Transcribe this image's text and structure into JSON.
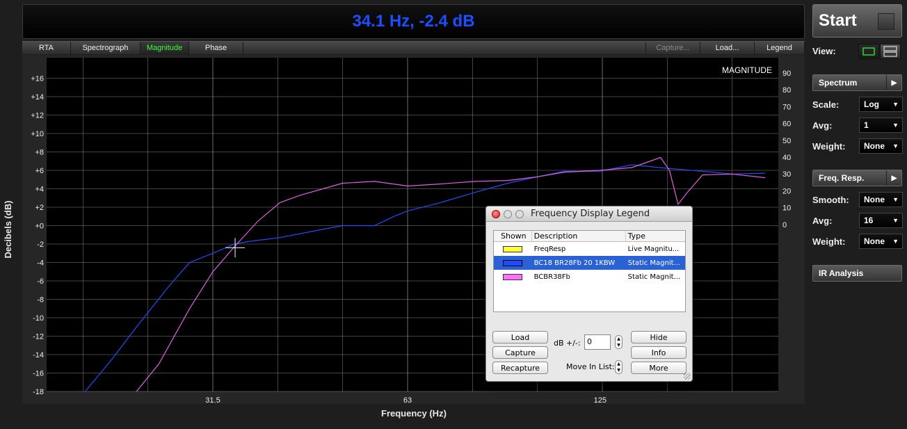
{
  "readout": "34.1 Hz, -2.4 dB",
  "tabs": {
    "left": [
      "RTA",
      "Spectrograph",
      "Magnitude",
      "Phase"
    ],
    "active": "Magnitude",
    "right": [
      "Capture...",
      "Load...",
      "Legend"
    ],
    "disabled": [
      "Capture..."
    ]
  },
  "plot": {
    "ylabel": "Decibels (dB)",
    "xlabel": "Frequency (Hz)",
    "mode_label": "MAGNITUDE",
    "left_ticks": [
      "+16",
      "+14",
      "+12",
      "+10",
      "+8",
      "+6",
      "+4",
      "+2",
      "+0",
      "-2",
      "-4",
      "-6",
      "-8",
      "-10",
      "-12",
      "-14",
      "-16",
      "-18"
    ],
    "right_ticks": [
      "90",
      "80",
      "70",
      "60",
      "50",
      "40",
      "30",
      "20",
      "10",
      "0"
    ],
    "x_ticks": [
      "31.5",
      "63",
      "125"
    ],
    "cursor": {
      "freq_hz": 34.1,
      "db": -2.4
    },
    "colors": {
      "background": "#000000",
      "grid": "#8a8a8a",
      "blue": "#1e4cff",
      "pink": "#e060e0"
    }
  },
  "chart_data": {
    "type": "line",
    "title": "MAGNITUDE",
    "xlabel": "Frequency (Hz)",
    "ylabel": "Decibels (dB)",
    "xscale": "log",
    "ylim": [
      -18,
      17
    ],
    "x_ticks": [
      31.5,
      63,
      125
    ],
    "series": [
      {
        "name": "BC18 BR28Fb 20 1KBW",
        "color": "#1e4cff",
        "points": [
          [
            20,
            -18
          ],
          [
            22,
            -14.5
          ],
          [
            24,
            -11
          ],
          [
            27,
            -6.5
          ],
          [
            29,
            -4
          ],
          [
            31.5,
            -3
          ],
          [
            34,
            -2
          ],
          [
            36,
            -1.7
          ],
          [
            40,
            -1.3
          ],
          [
            45,
            -0.6
          ],
          [
            50,
            0
          ],
          [
            56,
            0
          ],
          [
            60,
            1
          ],
          [
            63,
            1.6
          ],
          [
            70,
            2.4
          ],
          [
            80,
            3.6
          ],
          [
            90,
            4.6
          ],
          [
            100,
            5.3
          ],
          [
            110,
            5.9
          ],
          [
            125,
            5.9
          ],
          [
            140,
            6.6
          ],
          [
            160,
            6.2
          ],
          [
            180,
            5.9
          ],
          [
            200,
            5.6
          ],
          [
            225,
            5.7
          ]
        ]
      },
      {
        "name": "BCBR38Fb",
        "color": "#e060e0",
        "points": [
          [
            24,
            -18
          ],
          [
            26,
            -15
          ],
          [
            29,
            -9
          ],
          [
            31.5,
            -5
          ],
          [
            34,
            -2.3
          ],
          [
            37,
            0.5
          ],
          [
            40,
            2.5
          ],
          [
            43,
            3.3
          ],
          [
            50,
            4.6
          ],
          [
            56,
            4.8
          ],
          [
            63,
            4.3
          ],
          [
            70,
            4.5
          ],
          [
            80,
            4.8
          ],
          [
            90,
            4.9
          ],
          [
            100,
            5.3
          ],
          [
            110,
            5.8
          ],
          [
            125,
            6
          ],
          [
            140,
            6.3
          ],
          [
            155,
            7.4
          ],
          [
            160,
            6
          ],
          [
            165,
            2.3
          ],
          [
            170,
            3.5
          ],
          [
            180,
            5.5
          ],
          [
            200,
            5.6
          ],
          [
            225,
            5.2
          ]
        ]
      }
    ]
  },
  "panel": {
    "start_label": "Start",
    "view_label": "View:",
    "spectrum_label": "Spectrum",
    "scale_label": "Scale:",
    "scale_value": "Log",
    "avg_label": "Avg:",
    "avg_value": "1",
    "weight_label": "Weight:",
    "weight_value": "None",
    "freqresp_label": "Freq. Resp.",
    "smooth_label": "Smooth:",
    "smooth_value": "None",
    "avg2_label": "Avg:",
    "avg2_value": "16",
    "weight2_label": "Weight:",
    "weight2_value": "None",
    "ir_label": "IR Analysis"
  },
  "legend": {
    "title": "Frequency Display Legend",
    "headers": [
      "Shown",
      "Description",
      "Type"
    ],
    "rows": [
      {
        "color": "#ffff40",
        "description": "FreqResp",
        "type": "Live Magnitu..."
      },
      {
        "color": "#1e4cff",
        "description": "BC18 BR28Fb 20 1KBW",
        "type": "Static Magnit..."
      },
      {
        "color": "#ff70ff",
        "description": "BCBR38Fb",
        "type": "Static Magnit..."
      }
    ],
    "buttons": {
      "load": "Load",
      "capture": "Capture",
      "recapture": "Recapture",
      "hide": "Hide",
      "info": "Info",
      "more": "More"
    },
    "db_label": "dB +/-:",
    "db_value": "0",
    "move_label": "Move In List:"
  }
}
